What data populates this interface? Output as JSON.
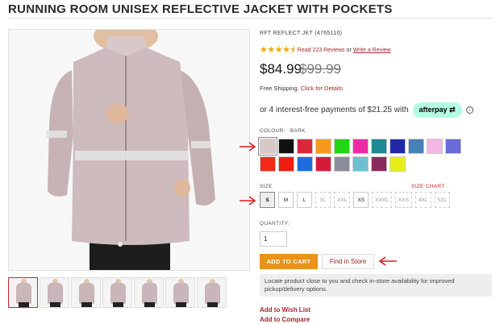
{
  "product": {
    "title": "RUNNING ROOM UNISEX REFLECTIVE JACKET WITH POCKETS",
    "sku": "RFT REFLECT JKT (4765110)",
    "rating_stars": 4.5,
    "reviews_link": "Read 223 Reviews",
    "or_text": "or",
    "write_review": "Write a Review",
    "price": "$84.99",
    "old_price": "$99.99",
    "shipping_text": "Free Shipping.",
    "shipping_link": "Click for Details",
    "installments": "or 4 interest-free payments of $21.25 with",
    "afterpay_label": "afterpay",
    "info_icon": "ⓘ"
  },
  "colour": {
    "label": "COLOUR:",
    "selected": "BARK",
    "swatches": [
      "#d8c8c6",
      "#111111",
      "#d8283a",
      "#f59a1f",
      "#22d616",
      "#ee2aa8",
      "#1b8a92",
      "#2128a8",
      "#4a80b8",
      "#f4b8e4",
      "#6a6ad8",
      "#f02a16",
      "#f11d10",
      "#1c6ee0",
      "#d61a3a",
      "#8a8e9a",
      "#6ec0d0",
      "#8a2a5a",
      "#e6f018"
    ],
    "selected_index": 0
  },
  "size": {
    "label": "SIZE",
    "chart_link": "SIZE CHART",
    "options": [
      {
        "label": "S",
        "state": "selected"
      },
      {
        "label": "M",
        "state": "available"
      },
      {
        "label": "L",
        "state": "available"
      },
      {
        "label": "XL",
        "state": "unavailable"
      },
      {
        "label": "XXL",
        "state": "unavailable"
      },
      {
        "label": "XS",
        "state": "available"
      },
      {
        "label": "XXXL",
        "state": "unavailable"
      },
      {
        "label": "XXS",
        "state": "unavailable"
      },
      {
        "label": "4XL",
        "state": "unavailable"
      },
      {
        "label": "5XL",
        "state": "unavailable"
      }
    ]
  },
  "quantity": {
    "label": "QUANTITY:",
    "value": "1"
  },
  "actions": {
    "add_to_cart": "ADD TO CART",
    "find_in_store": "Find in Store",
    "locate_text": "Locate product close to you and check in-store availability for improved pickup/delivery options.",
    "wishlist": "Add to Wish List",
    "compare": "Add to Compare"
  },
  "colors": {
    "accent": "#a0272d",
    "cart": "#e8931a",
    "arrow": "#d81f26",
    "afterpay": "#b2fce4"
  }
}
